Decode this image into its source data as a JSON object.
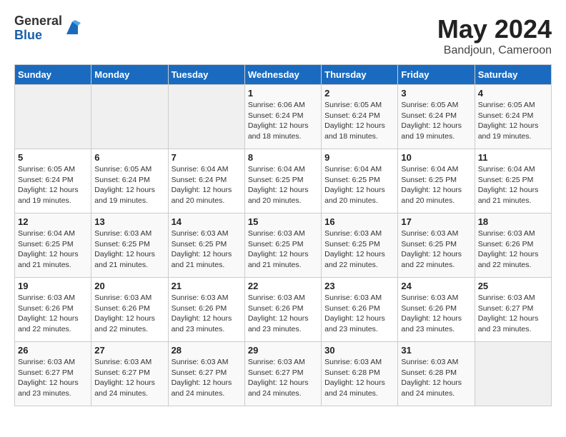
{
  "logo": {
    "general": "General",
    "blue": "Blue"
  },
  "title": "May 2024",
  "location": "Bandjoun, Cameroon",
  "days_header": [
    "Sunday",
    "Monday",
    "Tuesday",
    "Wednesday",
    "Thursday",
    "Friday",
    "Saturday"
  ],
  "weeks": [
    [
      {
        "day": "",
        "info": ""
      },
      {
        "day": "",
        "info": ""
      },
      {
        "day": "",
        "info": ""
      },
      {
        "day": "1",
        "info": "Sunrise: 6:06 AM\nSunset: 6:24 PM\nDaylight: 12 hours and 18 minutes."
      },
      {
        "day": "2",
        "info": "Sunrise: 6:05 AM\nSunset: 6:24 PM\nDaylight: 12 hours and 18 minutes."
      },
      {
        "day": "3",
        "info": "Sunrise: 6:05 AM\nSunset: 6:24 PM\nDaylight: 12 hours and 19 minutes."
      },
      {
        "day": "4",
        "info": "Sunrise: 6:05 AM\nSunset: 6:24 PM\nDaylight: 12 hours and 19 minutes."
      }
    ],
    [
      {
        "day": "5",
        "info": "Sunrise: 6:05 AM\nSunset: 6:24 PM\nDaylight: 12 hours and 19 minutes."
      },
      {
        "day": "6",
        "info": "Sunrise: 6:05 AM\nSunset: 6:24 PM\nDaylight: 12 hours and 19 minutes."
      },
      {
        "day": "7",
        "info": "Sunrise: 6:04 AM\nSunset: 6:24 PM\nDaylight: 12 hours and 20 minutes."
      },
      {
        "day": "8",
        "info": "Sunrise: 6:04 AM\nSunset: 6:25 PM\nDaylight: 12 hours and 20 minutes."
      },
      {
        "day": "9",
        "info": "Sunrise: 6:04 AM\nSunset: 6:25 PM\nDaylight: 12 hours and 20 minutes."
      },
      {
        "day": "10",
        "info": "Sunrise: 6:04 AM\nSunset: 6:25 PM\nDaylight: 12 hours and 20 minutes."
      },
      {
        "day": "11",
        "info": "Sunrise: 6:04 AM\nSunset: 6:25 PM\nDaylight: 12 hours and 21 minutes."
      }
    ],
    [
      {
        "day": "12",
        "info": "Sunrise: 6:04 AM\nSunset: 6:25 PM\nDaylight: 12 hours and 21 minutes."
      },
      {
        "day": "13",
        "info": "Sunrise: 6:03 AM\nSunset: 6:25 PM\nDaylight: 12 hours and 21 minutes."
      },
      {
        "day": "14",
        "info": "Sunrise: 6:03 AM\nSunset: 6:25 PM\nDaylight: 12 hours and 21 minutes."
      },
      {
        "day": "15",
        "info": "Sunrise: 6:03 AM\nSunset: 6:25 PM\nDaylight: 12 hours and 21 minutes."
      },
      {
        "day": "16",
        "info": "Sunrise: 6:03 AM\nSunset: 6:25 PM\nDaylight: 12 hours and 22 minutes."
      },
      {
        "day": "17",
        "info": "Sunrise: 6:03 AM\nSunset: 6:25 PM\nDaylight: 12 hours and 22 minutes."
      },
      {
        "day": "18",
        "info": "Sunrise: 6:03 AM\nSunset: 6:26 PM\nDaylight: 12 hours and 22 minutes."
      }
    ],
    [
      {
        "day": "19",
        "info": "Sunrise: 6:03 AM\nSunset: 6:26 PM\nDaylight: 12 hours and 22 minutes."
      },
      {
        "day": "20",
        "info": "Sunrise: 6:03 AM\nSunset: 6:26 PM\nDaylight: 12 hours and 22 minutes."
      },
      {
        "day": "21",
        "info": "Sunrise: 6:03 AM\nSunset: 6:26 PM\nDaylight: 12 hours and 23 minutes."
      },
      {
        "day": "22",
        "info": "Sunrise: 6:03 AM\nSunset: 6:26 PM\nDaylight: 12 hours and 23 minutes."
      },
      {
        "day": "23",
        "info": "Sunrise: 6:03 AM\nSunset: 6:26 PM\nDaylight: 12 hours and 23 minutes."
      },
      {
        "day": "24",
        "info": "Sunrise: 6:03 AM\nSunset: 6:26 PM\nDaylight: 12 hours and 23 minutes."
      },
      {
        "day": "25",
        "info": "Sunrise: 6:03 AM\nSunset: 6:27 PM\nDaylight: 12 hours and 23 minutes."
      }
    ],
    [
      {
        "day": "26",
        "info": "Sunrise: 6:03 AM\nSunset: 6:27 PM\nDaylight: 12 hours and 23 minutes."
      },
      {
        "day": "27",
        "info": "Sunrise: 6:03 AM\nSunset: 6:27 PM\nDaylight: 12 hours and 24 minutes."
      },
      {
        "day": "28",
        "info": "Sunrise: 6:03 AM\nSunset: 6:27 PM\nDaylight: 12 hours and 24 minutes."
      },
      {
        "day": "29",
        "info": "Sunrise: 6:03 AM\nSunset: 6:27 PM\nDaylight: 12 hours and 24 minutes."
      },
      {
        "day": "30",
        "info": "Sunrise: 6:03 AM\nSunset: 6:28 PM\nDaylight: 12 hours and 24 minutes."
      },
      {
        "day": "31",
        "info": "Sunrise: 6:03 AM\nSunset: 6:28 PM\nDaylight: 12 hours and 24 minutes."
      },
      {
        "day": "",
        "info": ""
      }
    ]
  ]
}
